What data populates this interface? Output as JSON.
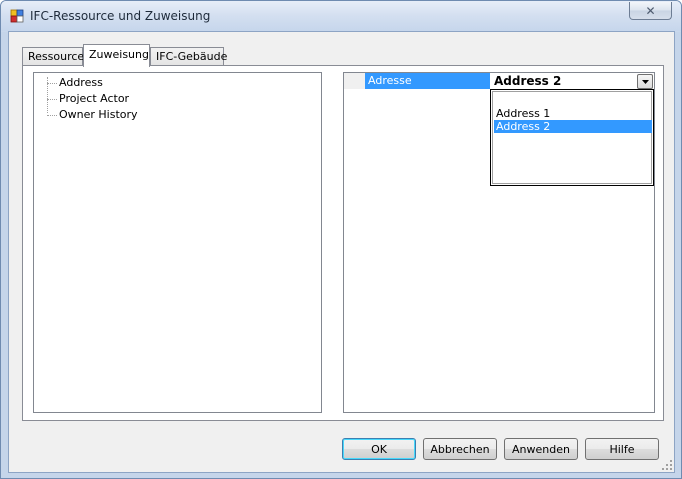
{
  "window": {
    "title": "IFC-Ressource und Zuweisung",
    "close_glyph": "✕"
  },
  "tabs": [
    {
      "label": "Ressource",
      "active": false
    },
    {
      "label": "Zuweisung",
      "active": true
    },
    {
      "label": "IFC-Gebäude",
      "active": false
    }
  ],
  "tree": {
    "items": [
      {
        "label": "Address"
      },
      {
        "label": "Project Actor"
      },
      {
        "label": "Owner History"
      }
    ]
  },
  "property_grid": {
    "property_name": "Adresse",
    "property_value": "Address 2",
    "options": [
      "Address 1",
      "Address 2"
    ],
    "selected_option": "Address 2"
  },
  "buttons": {
    "ok": "OK",
    "cancel": "Abbrechen",
    "apply": "Anwenden",
    "help": "Hilfe"
  },
  "colors": {
    "selection": "#3399ff",
    "dialog_bg": "#f0f0f0",
    "title_text": "#1e2a3a"
  },
  "icons": {
    "app": "app-icon",
    "close": "close-icon",
    "dropdown": "chevron-down-icon",
    "resize": "size-grip-icon"
  }
}
